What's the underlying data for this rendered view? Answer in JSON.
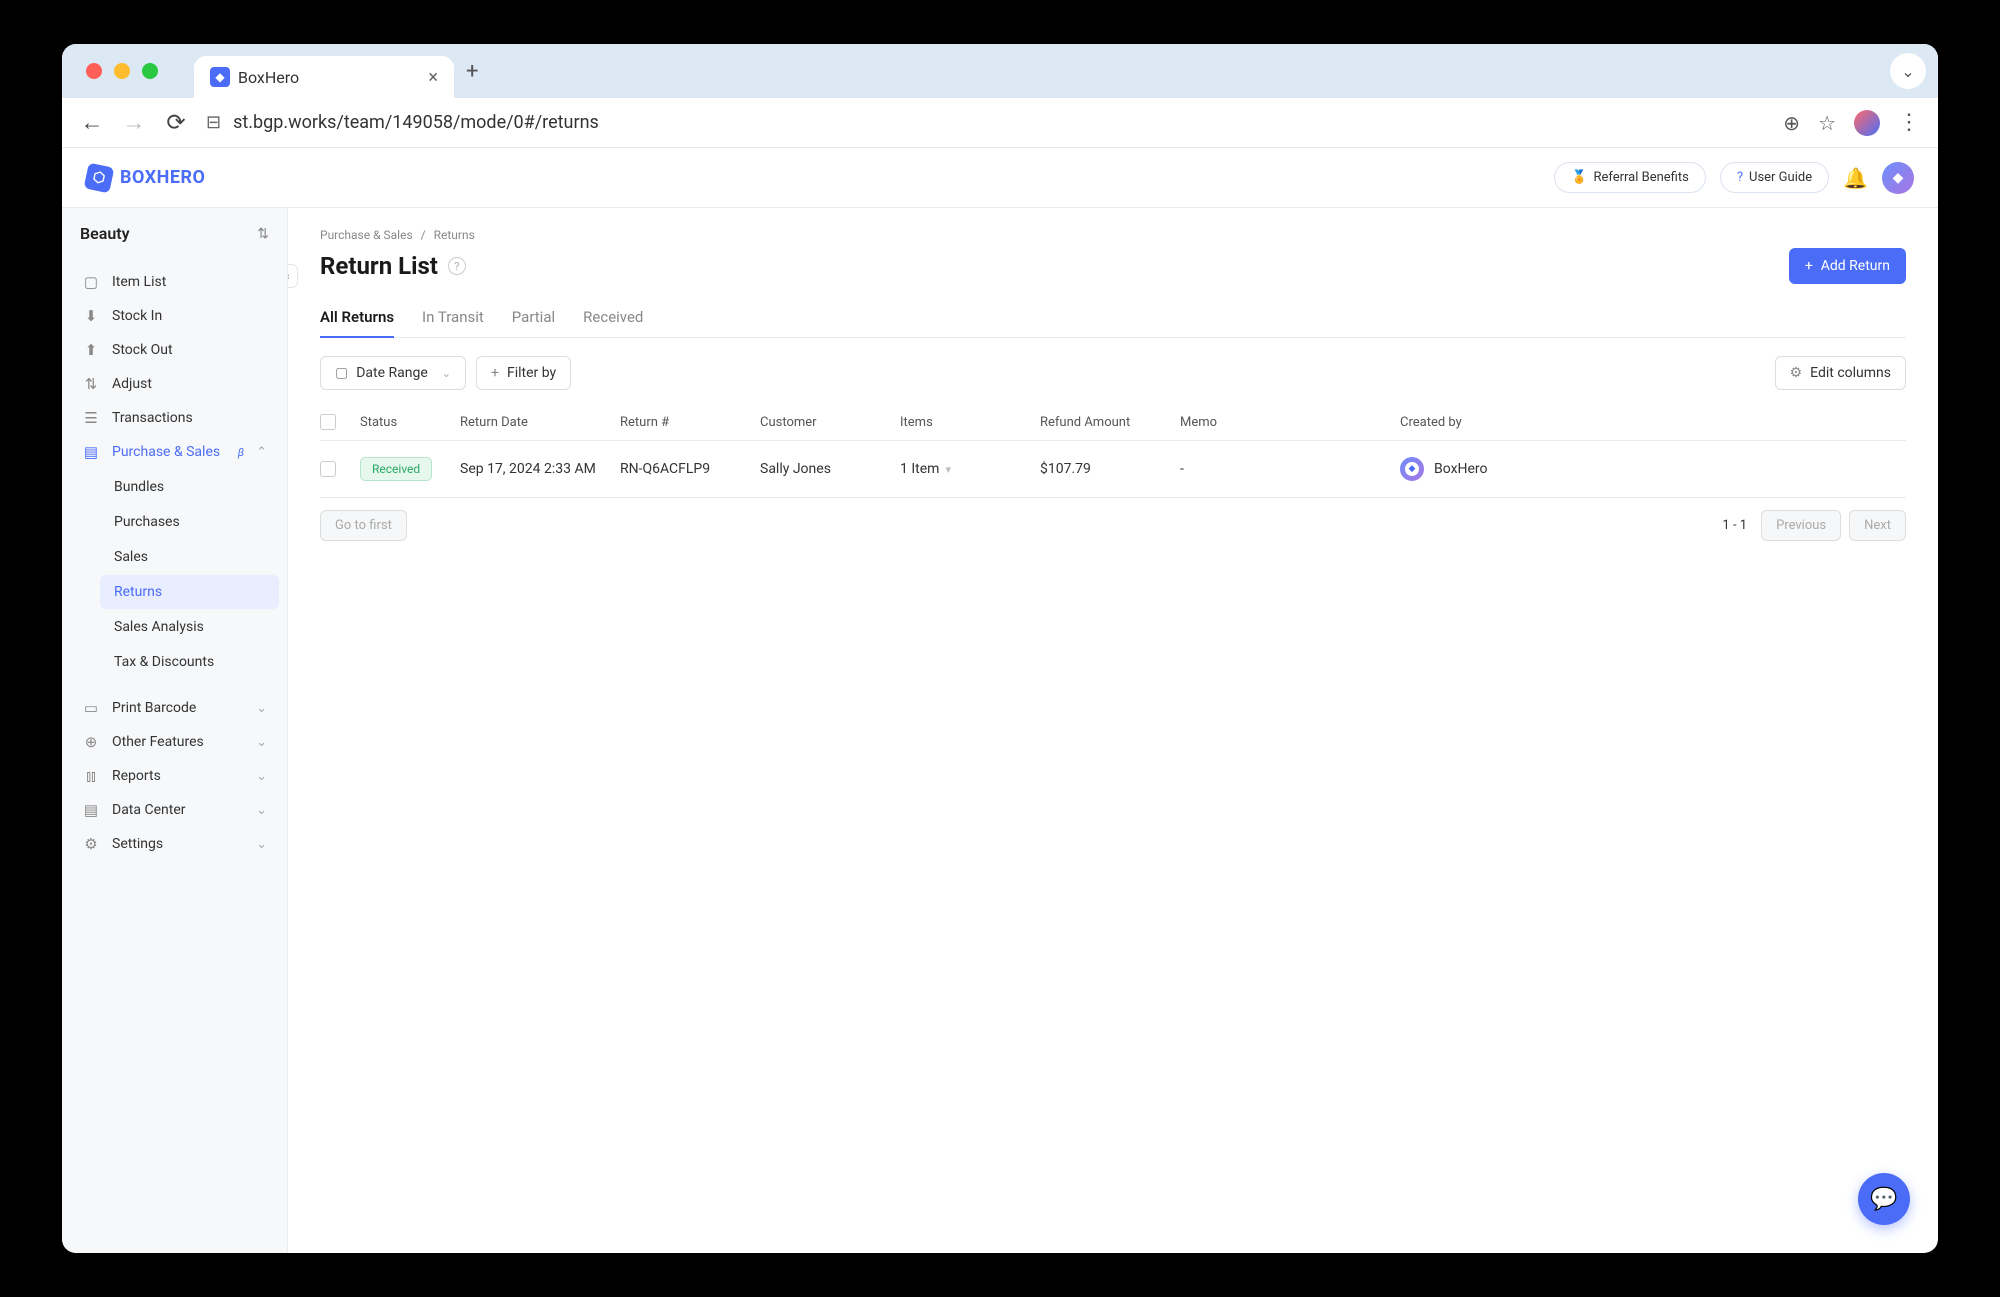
{
  "browser": {
    "tab_title": "BoxHero",
    "url": "st.bgp.works/team/149058/mode/0#/returns"
  },
  "header": {
    "logo_text": "BOXHERO",
    "referral_btn": "Referral Benefits",
    "user_guide_btn": "User Guide"
  },
  "sidebar": {
    "team": "Beauty",
    "items": [
      {
        "label": "Item List",
        "icon": "📋"
      },
      {
        "label": "Stock In",
        "icon": "⬇"
      },
      {
        "label": "Stock Out",
        "icon": "⬆"
      },
      {
        "label": "Adjust",
        "icon": "⇅"
      },
      {
        "label": "Transactions",
        "icon": "≡"
      }
    ],
    "purchase_sales_label": "Purchase & Sales",
    "purchase_sales_beta": "β",
    "subitems": [
      {
        "label": "Bundles"
      },
      {
        "label": "Purchases"
      },
      {
        "label": "Sales"
      },
      {
        "label": "Returns"
      },
      {
        "label": "Sales Analysis"
      },
      {
        "label": "Tax & Discounts"
      }
    ],
    "bottom_items": [
      {
        "label": "Print Barcode",
        "icon": "▭"
      },
      {
        "label": "Other Features",
        "icon": "⊕"
      },
      {
        "label": "Reports",
        "icon": "📊"
      },
      {
        "label": "Data Center",
        "icon": "▤"
      },
      {
        "label": "Settings",
        "icon": "⚙"
      }
    ]
  },
  "breadcrumb": {
    "parent": "Purchase & Sales",
    "current": "Returns"
  },
  "page": {
    "title": "Return List",
    "add_btn": "Add Return",
    "tabs": [
      "All Returns",
      "In Transit",
      "Partial",
      "Received"
    ],
    "date_range_btn": "Date Range",
    "filter_btn": "Filter by",
    "edit_columns_btn": "Edit columns"
  },
  "table": {
    "headers": [
      "Status",
      "Return Date",
      "Return #",
      "Customer",
      "Items",
      "Refund Amount",
      "Memo",
      "Created by"
    ],
    "rows": [
      {
        "status": "Received",
        "return_date": "Sep 17, 2024 2:33 AM",
        "return_no": "RN-Q6ACFLP9",
        "customer": "Sally Jones",
        "items": "1 Item",
        "refund_amount": "$107.79",
        "memo": "-",
        "created_by": "BoxHero"
      }
    ]
  },
  "pagination": {
    "go_to_first": "Go to first",
    "page_info": "1 - 1",
    "previous": "Previous",
    "next": "Next"
  }
}
